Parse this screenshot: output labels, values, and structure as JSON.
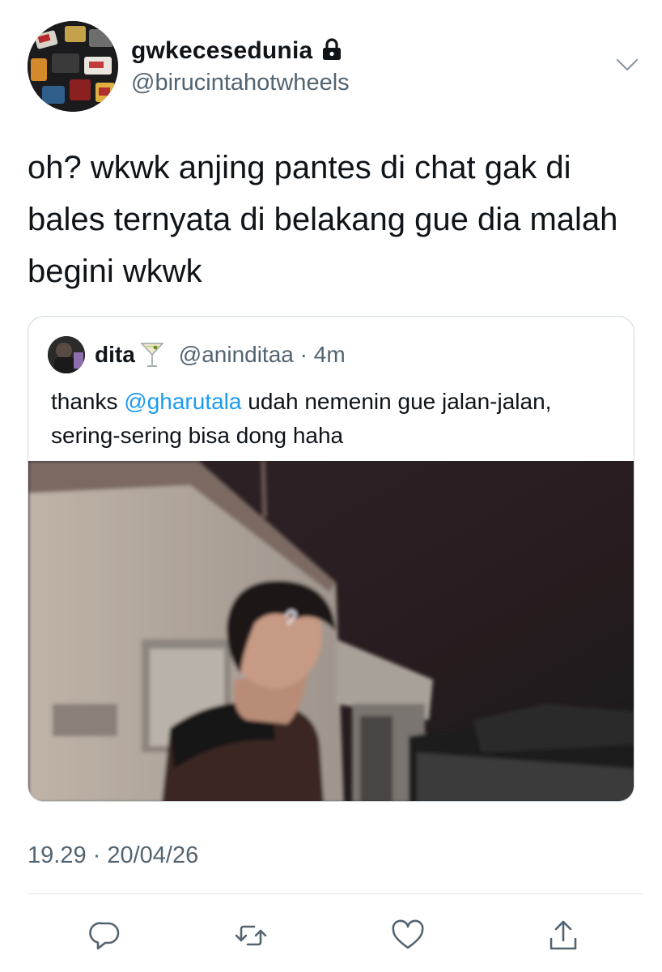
{
  "header": {
    "display_name": "gwkecesedunia",
    "handle": "@birucintahotwheels",
    "icons": [
      "lock-icon",
      "chevron-down-icon"
    ]
  },
  "tweet": {
    "text": "oh? wkwk anjing pantes di chat gak di bales ternyata di belakang gue dia malah begini wkwk"
  },
  "quote": {
    "name": "dita",
    "handle_time": "@aninditaa · 4m",
    "text_before": "thanks ",
    "mention": "@gharutala",
    "text_after": " udah nemenin gue jalan-jalan, sering-sering bisa dong haha",
    "icons": [
      "martini-icon"
    ]
  },
  "meta": {
    "timestamp": "19.29 · 20/04/26"
  },
  "colors": {
    "text": "#0f1419",
    "secondary": "#536471",
    "link": "#1d9bf0",
    "border": "#cfd9de"
  },
  "actions": [
    "reply-icon",
    "retweet-icon",
    "like-icon",
    "share-icon"
  ]
}
